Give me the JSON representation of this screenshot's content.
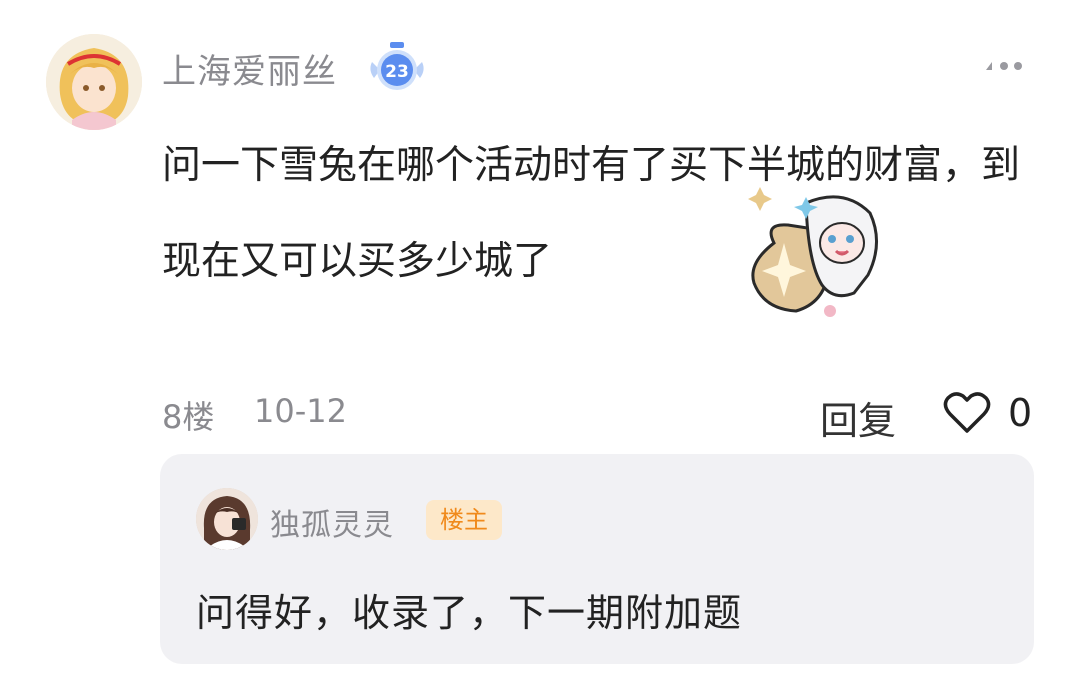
{
  "comment": {
    "username": "上海爱丽丝",
    "level": "23",
    "text": "问一下雪兔在哪个活动时有了买下半城的财富，到现在又可以买多少城了",
    "floor": "8楼",
    "date": "10-12",
    "reply_label": "回复",
    "like_count": "0",
    "icons": {
      "more": "more-options-icon",
      "like": "heart-icon",
      "level": "level-badge-icon"
    }
  },
  "reply": {
    "username": "独孤灵灵",
    "badge": "楼主",
    "text": "问得好，收录了，下一期附加题"
  },
  "colors": {
    "host_badge_bg": "#fde8c9",
    "host_badge_text": "#f08a1c",
    "level_badge": "#5b8def",
    "reply_bg": "#f1f1f4"
  }
}
